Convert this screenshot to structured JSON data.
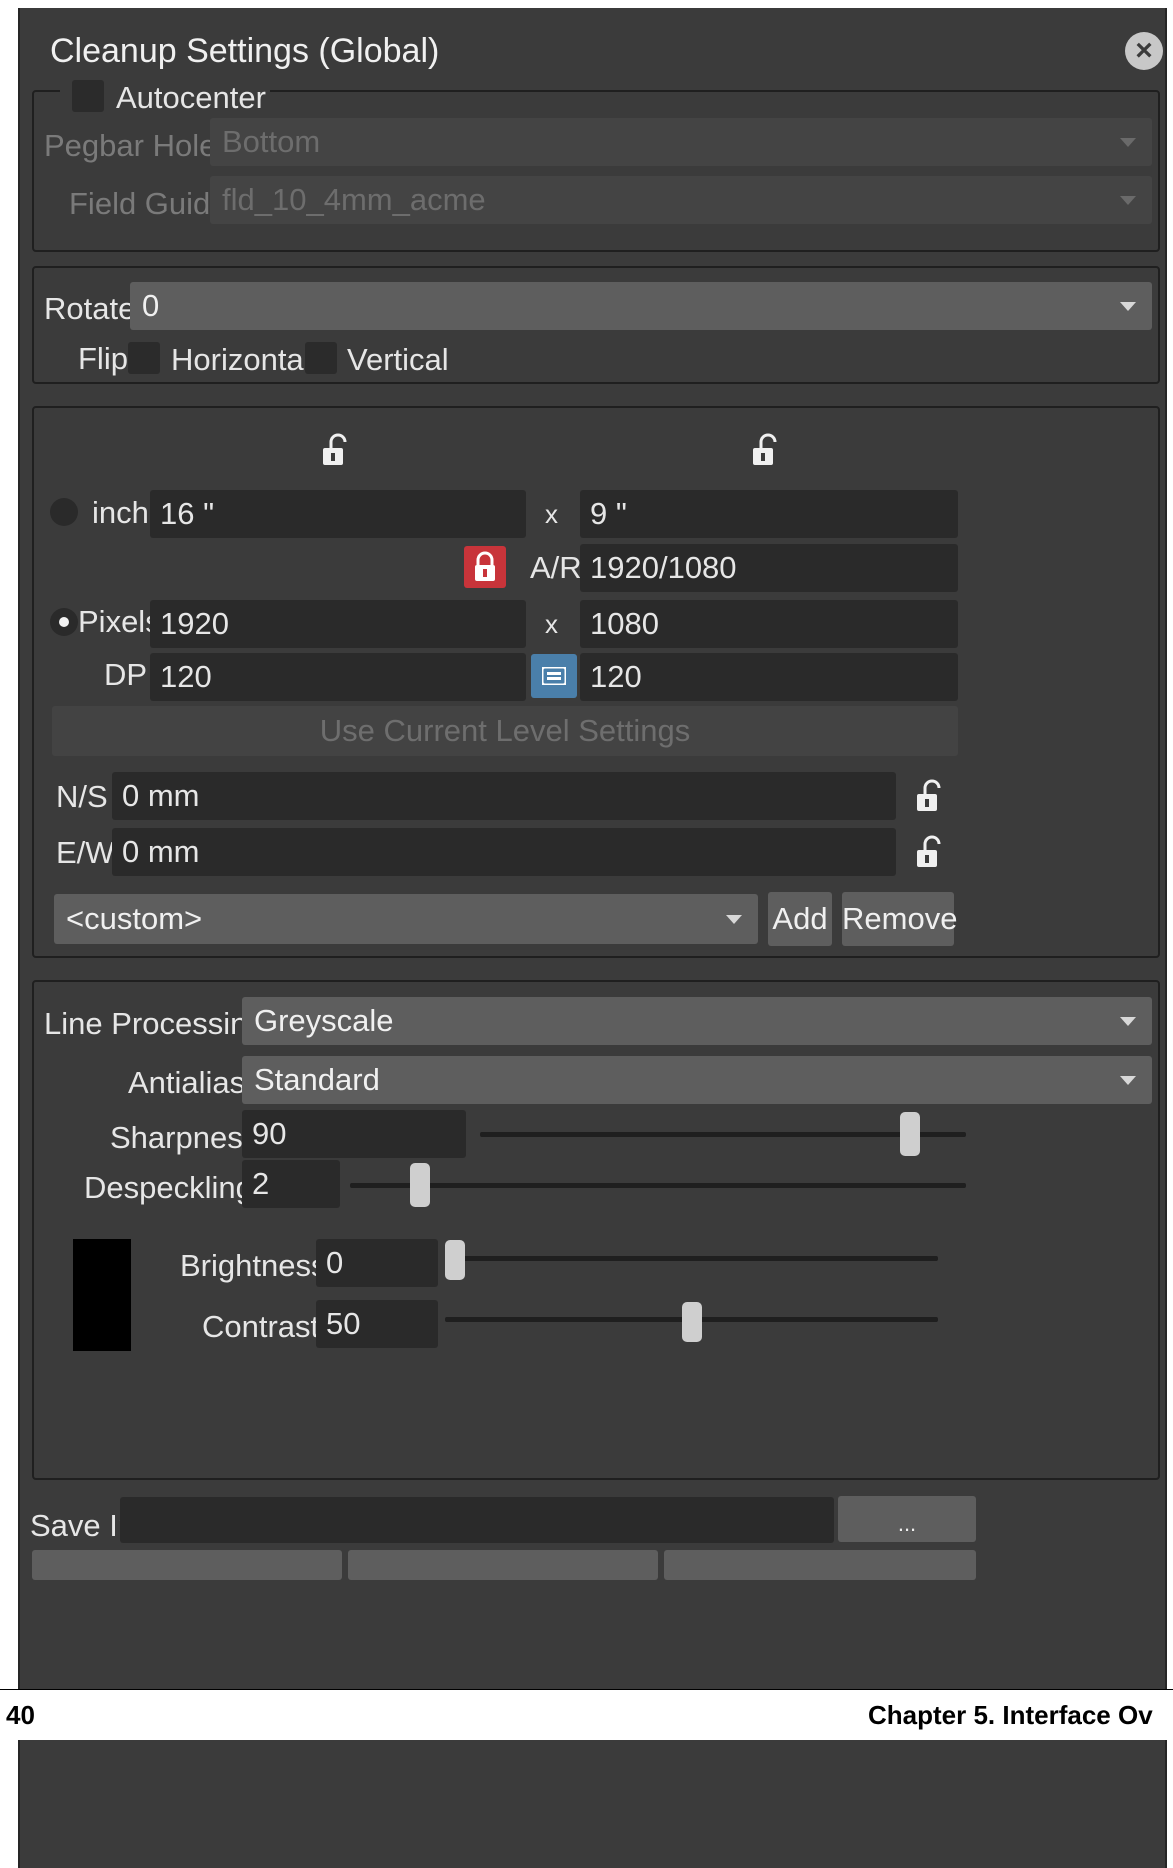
{
  "window": {
    "title": "Cleanup Settings (Global)"
  },
  "autocenter": {
    "label": "Autocenter",
    "pegbar_label": "Pegbar Holes",
    "pegbar_value": "Bottom",
    "field_guide_label": "Field Guide",
    "field_guide_value": "fld_10_4mm_acme"
  },
  "orientation": {
    "rotate_label": "Rotate",
    "rotate_value": "0",
    "flip_label": "Flip",
    "horizontal_label": "Horizontal",
    "vertical_label": "Vertical"
  },
  "camera": {
    "inch_label": "inch",
    "inch_width": "16 \"",
    "inch_height": "9 \"",
    "x_sep": "x",
    "ar_label": "A/R",
    "ar_value": "1920/1080",
    "pixels_label": "Pixels",
    "pixels_width": "1920",
    "pixels_height": "1080",
    "dpi_label": "DPI",
    "dpi_x": "120",
    "dpi_y": "120",
    "use_current_label": "Use Current Level Settings",
    "ns_label": "N/S",
    "ns_value": "0 mm",
    "ew_label": "E/W",
    "ew_value": "0 mm",
    "preset_value": "<custom>",
    "add_label": "Add",
    "remove_label": "Remove"
  },
  "processing": {
    "line_processing_label": "Line Processing:",
    "line_processing_value": "Greyscale",
    "antialias_label": "Antialias:",
    "antialias_value": "Standard",
    "sharpness_label": "Sharpness:",
    "sharpness_value": "90",
    "despeckling_label": "Despeckling:",
    "despeckling_value": "2",
    "brightness_label": "Brightness:",
    "brightness_value": "0",
    "contrast_label": "Contrast:",
    "contrast_value": "50",
    "swatch_color": "#000000"
  },
  "save": {
    "label": "Save In",
    "browse_label": "..."
  },
  "page_footer": {
    "page_number": "40",
    "chapter": "Chapter 5.  Interface Ov"
  },
  "colors": {
    "panel_bg": "#3b3b3b",
    "field_bg": "#2a2a2a",
    "lock_active": "#c8343a",
    "link_active": "#4a7faa"
  }
}
